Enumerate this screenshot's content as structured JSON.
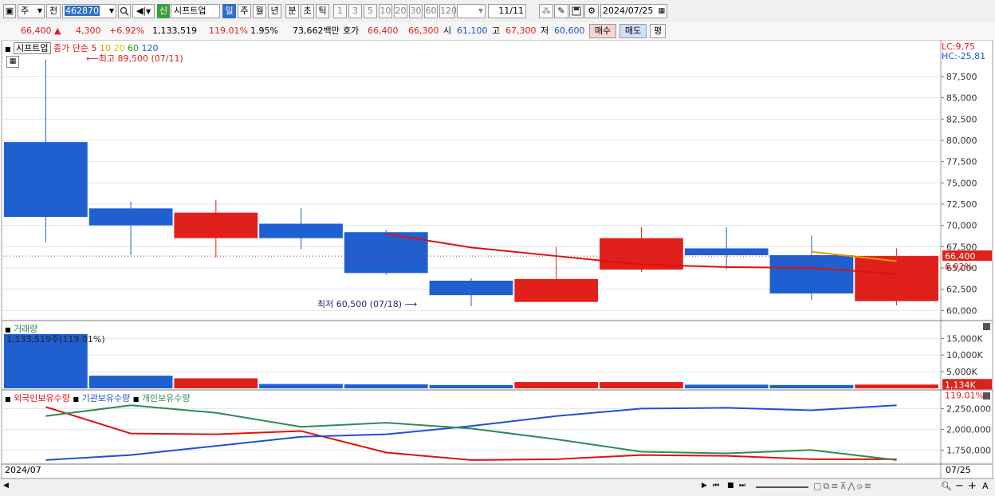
{
  "toolbar": {
    "period_type": "주",
    "prev_label": "전",
    "code": "462870",
    "new_badge": "신",
    "stock_name": "시프트업",
    "periods": [
      "일",
      "주",
      "월",
      "년",
      "분",
      "초",
      "틱"
    ],
    "active_period": "일",
    "intervals": [
      "1",
      "3",
      "5",
      "10",
      "20",
      "30",
      "60",
      "120"
    ],
    "count": "11",
    "count_total": "/11",
    "date": "2024/07/25"
  },
  "quote": {
    "price": "66,400",
    "arrow": "▲",
    "change": "4,300",
    "change_pct": "+6.92%",
    "volume": "1,133,519",
    "vol_ratio": "119.01%",
    "turnover": "1.95%",
    "amount": "73,662백만",
    "bid_label": "호가",
    "ask": "66,400",
    "bid": "66,300",
    "open_label": "시",
    "open": "61,100",
    "high_label": "고",
    "high": "67,300",
    "low_label": "저",
    "low": "60,600",
    "buy_label": "매수",
    "sell_label": "매도",
    "flat_label": "평"
  },
  "price_panel": {
    "legend_name": "시프트업",
    "legend_ma": "종가 단순",
    "ma_periods": [
      "5",
      "10",
      "20",
      "60",
      "120"
    ],
    "ma_colors": [
      "#e01010",
      "#e0a000",
      "#e0c000",
      "#20a020",
      "#1060d0"
    ],
    "lc": "LC:9,75",
    "hc": "HC:-25,81",
    "max_note": "최고 89,500 (07/11)",
    "min_note": "최저 60,500 (07/18)",
    "cur_price_tag": "66,400",
    "cur_pct_tag": "6.92%",
    "y_ticks": [
      "87,500",
      "85,000",
      "82,500",
      "80,000",
      "77,500",
      "75,000",
      "72,500",
      "70,000",
      "67,500",
      "65,000",
      "62,500",
      "60,000"
    ]
  },
  "volume_panel": {
    "title": "거래량",
    "info": "1,133,519주(119.01%)",
    "y_ticks": [
      "15,000K",
      "10,000K",
      "5,000K"
    ],
    "cur_tag": "1,134K",
    "cur_pct": "119.01%"
  },
  "holdings_panel": {
    "legend": [
      "외국인보유수량",
      "기관보유수량",
      "개인보유수량"
    ],
    "legend_colors": [
      "#e01010",
      "#1f4fd8",
      "#2e8b57"
    ],
    "y_ticks": [
      "2,250,000",
      "2,000,000",
      "1,750,000"
    ]
  },
  "xaxis": {
    "left": "2024/07",
    "right": "07/25"
  },
  "chart_data": [
    {
      "type": "candlestick",
      "series": [
        {
          "open": 79800,
          "high": 89500,
          "low": 68000,
          "close": 71000,
          "color": "#1f5fd0"
        },
        {
          "open": 72000,
          "high": 72800,
          "low": 66500,
          "close": 70000,
          "color": "#1f5fd0"
        },
        {
          "open": 68500,
          "high": 73000,
          "low": 66200,
          "close": 71500,
          "color": "#e0201a"
        },
        {
          "open": 70200,
          "high": 72000,
          "low": 67200,
          "close": 68500,
          "color": "#1f5fd0"
        },
        {
          "open": 69200,
          "high": 69500,
          "low": 64200,
          "close": 64400,
          "color": "#1f5fd0"
        },
        {
          "open": 63500,
          "high": 63800,
          "low": 60500,
          "close": 61800,
          "color": "#1f5fd0"
        },
        {
          "open": 61000,
          "high": 67500,
          "low": 61000,
          "close": 63700,
          "color": "#e0201a"
        },
        {
          "open": 64800,
          "high": 69800,
          "low": 64500,
          "close": 68500,
          "color": "#e0201a"
        },
        {
          "open": 67300,
          "high": 69800,
          "low": 64800,
          "close": 66500,
          "color": "#1f5fd0"
        },
        {
          "open": 66500,
          "high": 68800,
          "low": 61200,
          "close": 62000,
          "color": "#1f5fd0"
        },
        {
          "open": 61100,
          "high": 67300,
          "low": 60600,
          "close": 66400,
          "color": "#e0201a"
        }
      ],
      "ma5": [
        null,
        null,
        null,
        null,
        69000,
        67400,
        66400,
        65400,
        65100,
        65000,
        64300
      ],
      "ylim": [
        59000,
        90500
      ]
    },
    {
      "type": "bar",
      "title": "거래량",
      "values": [
        16300,
        3800,
        3000,
        1300,
        1200,
        1000,
        1900,
        1900,
        1100,
        1000,
        1134
      ],
      "colors": [
        "#1f5fd0",
        "#1f5fd0",
        "#e0201a",
        "#1f5fd0",
        "#1f5fd0",
        "#1f5fd0",
        "#e0201a",
        "#e0201a",
        "#1f5fd0",
        "#1f5fd0",
        "#e0201a"
      ],
      "ylim": [
        0,
        17000
      ]
    },
    {
      "type": "line",
      "series": [
        {
          "name": "외국인보유수량",
          "values": [
            2270000,
            1950000,
            1940000,
            1980000,
            1720000,
            1630000,
            1640000,
            1690000,
            1680000,
            1640000,
            1640000
          ]
        },
        {
          "name": "기관보유수량",
          "values": [
            1630000,
            1690000,
            1800000,
            1910000,
            1940000,
            2040000,
            2160000,
            2250000,
            2260000,
            2230000,
            2290000
          ]
        },
        {
          "name": "개인보유수량",
          "values": [
            2160000,
            2290000,
            2200000,
            2030000,
            2080000,
            2010000,
            1880000,
            1730000,
            1710000,
            1750000,
            1630000
          ]
        }
      ],
      "ylim": [
        1600000,
        2350000
      ]
    }
  ]
}
